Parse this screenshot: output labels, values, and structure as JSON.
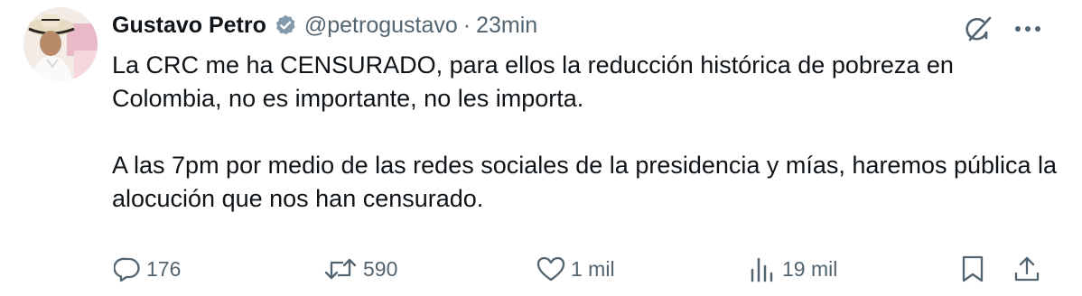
{
  "author": {
    "display_name": "Gustavo Petro",
    "handle": "@petrogustavo",
    "separator": "·",
    "time": "23min",
    "verified": true
  },
  "tweet": {
    "paragraphs": [
      "La CRC me ha CENSURADO, para ellos la reducción histórica de pobreza en Colombia, no es importante, no les importa.",
      "A las 7pm por medio de las redes sociales de la presidencia y mías, haremos pública la alocución que nos han censurado."
    ]
  },
  "actions": {
    "replies": "176",
    "reposts": "590",
    "likes": "1 mil",
    "views": "19 mil"
  },
  "icons": {
    "reply": "speech-bubble-icon",
    "repost": "repost-arrows-icon",
    "like": "heart-icon",
    "views": "bar-chart-icon",
    "bookmark": "bookmark-icon",
    "share": "share-upload-icon",
    "grok": "grok-slash-icon",
    "more": "ellipsis-icon",
    "verified": "verified-badge-icon"
  },
  "colors": {
    "text": "#0f1419",
    "secondary": "#536471",
    "verified_badge": "#829aab"
  }
}
